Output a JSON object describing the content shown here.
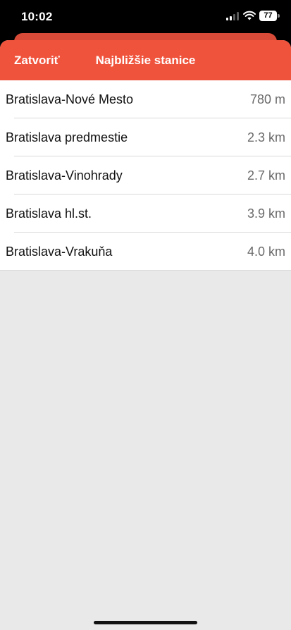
{
  "status_bar": {
    "time": "10:02",
    "battery_percent": "77",
    "signal_bars_active": 2,
    "signal_bars_total": 4
  },
  "nav": {
    "close_label": "Zatvoriť",
    "title": "Najbližšie stanice"
  },
  "stations": [
    {
      "name": "Bratislava-Nové Mesto",
      "distance": "780 m"
    },
    {
      "name": "Bratislava predmestie",
      "distance": "2.3 km"
    },
    {
      "name": "Bratislava-Vinohrady",
      "distance": "2.7 km"
    },
    {
      "name": "Bratislava hl.st.",
      "distance": "3.9 km"
    },
    {
      "name": "Bratislava-Vrakuňa",
      "distance": "4.0 km"
    }
  ],
  "colors": {
    "accent": "#f0533c",
    "background": "#e9e9e9",
    "list_background": "#ffffff"
  },
  "icons": [
    "signal-icon",
    "wifi-icon",
    "battery-icon"
  ]
}
